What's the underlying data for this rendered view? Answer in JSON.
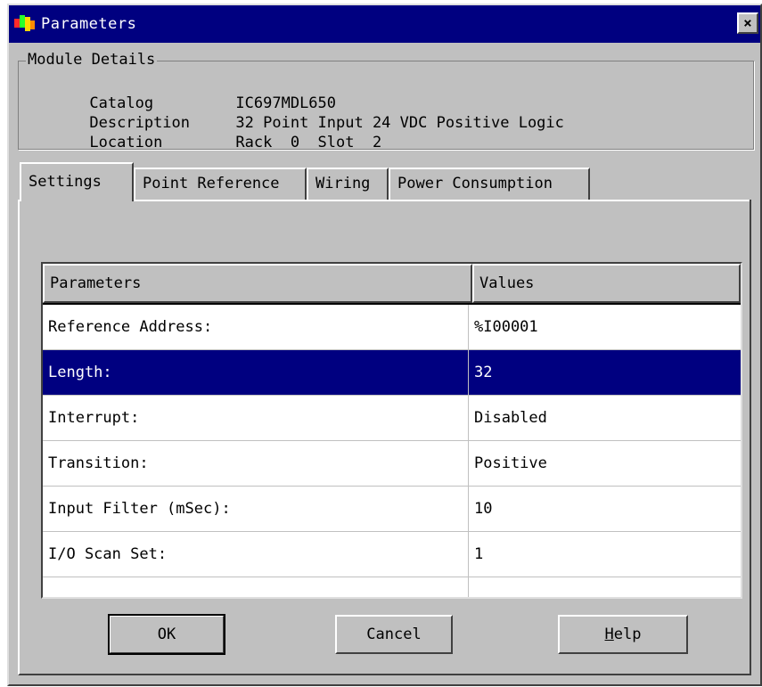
{
  "window": {
    "title": "Parameters",
    "close_label": "×"
  },
  "module_details": {
    "legend": "Module Details",
    "catalog_label": "Catalog",
    "catalog_value": "IC697MDL650",
    "description_label": "Description",
    "description_value": "32 Point Input 24 VDC Positive Logic",
    "location_label": "Location",
    "location_value": "Rack  0  Slot  2"
  },
  "tabs": [
    {
      "label": "Settings",
      "active": true
    },
    {
      "label": "Point Reference",
      "active": false
    },
    {
      "label": "Wiring",
      "active": false
    },
    {
      "label": "Power Consumption",
      "active": false
    }
  ],
  "grid": {
    "columns": [
      "Parameters",
      "Values"
    ],
    "rows": [
      {
        "parameter": "Reference Address:",
        "value": "%I00001",
        "selected": false
      },
      {
        "parameter": "Length:",
        "value": "32",
        "selected": true
      },
      {
        "parameter": "Interrupt:",
        "value": "Disabled",
        "selected": false
      },
      {
        "parameter": "Transition:",
        "value": "Positive",
        "selected": false
      },
      {
        "parameter": "Input Filter (mSec):",
        "value": "10",
        "selected": false
      },
      {
        "parameter": "I/O Scan Set:",
        "value": "1",
        "selected": false
      },
      {
        "parameter": "",
        "value": "",
        "selected": false
      }
    ]
  },
  "buttons": {
    "ok": "OK",
    "cancel": "Cancel",
    "help_accel": "H",
    "help_rest": "elp"
  },
  "colors": {
    "titlebar": "#000080",
    "selection": "#000080",
    "face": "#c0c0c0"
  }
}
